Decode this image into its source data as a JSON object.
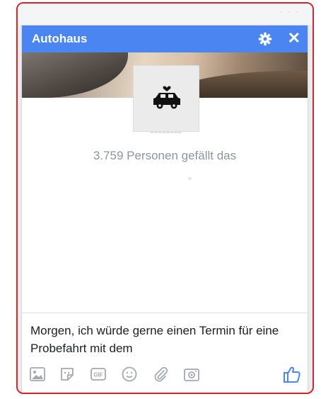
{
  "chat": {
    "title": "Autohaus",
    "likes_text": "3.759 Personen gefällt das",
    "message_draft": "Morgen, ich würde gerne einen Termin für eine Probefahrt mit dem",
    "gif_label": "GIF"
  },
  "colors": {
    "header": "#4a85f2",
    "frame_border": "#d8232a",
    "like_icon": "#4a85f2"
  },
  "icons": {
    "header": [
      "gear-icon",
      "close-icon"
    ],
    "toolbar": [
      "image-icon",
      "sticker-icon",
      "gif-icon",
      "emoji-icon",
      "attachment-icon",
      "camera-icon",
      "thumbs-up-icon"
    ]
  }
}
